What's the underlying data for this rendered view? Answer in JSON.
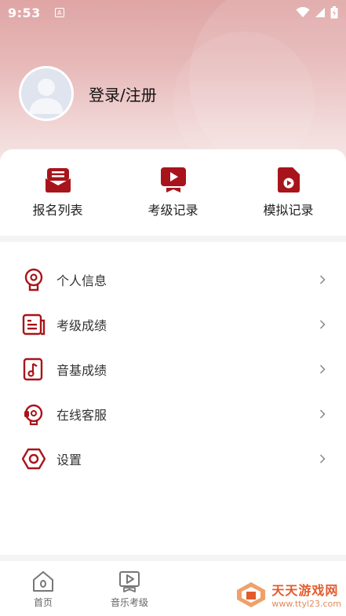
{
  "status": {
    "time": "9:53",
    "a_badge": "A"
  },
  "profile": {
    "login_label": "登录/注册"
  },
  "quick": [
    {
      "label": "报名列表",
      "icon": "envelope-icon"
    },
    {
      "label": "考级记录",
      "icon": "video-play-icon"
    },
    {
      "label": "模拟记录",
      "icon": "file-play-icon"
    }
  ],
  "menu": [
    {
      "label": "个人信息",
      "icon": "person-info-icon"
    },
    {
      "label": "考级成绩",
      "icon": "score-document-icon"
    },
    {
      "label": "音基成绩",
      "icon": "music-note-icon"
    },
    {
      "label": "在线客服",
      "icon": "headset-icon"
    },
    {
      "label": "设置",
      "icon": "settings-icon"
    }
  ],
  "tabs": [
    {
      "label": "首页",
      "icon": "home-icon"
    },
    {
      "label": "音乐考级",
      "icon": "music-exam-icon"
    }
  ],
  "watermark": {
    "title": "天天游戏网",
    "url": "www.ttyl23.com"
  },
  "colors": {
    "accent": "#a8141b",
    "header_top": "#dfa5a5"
  }
}
